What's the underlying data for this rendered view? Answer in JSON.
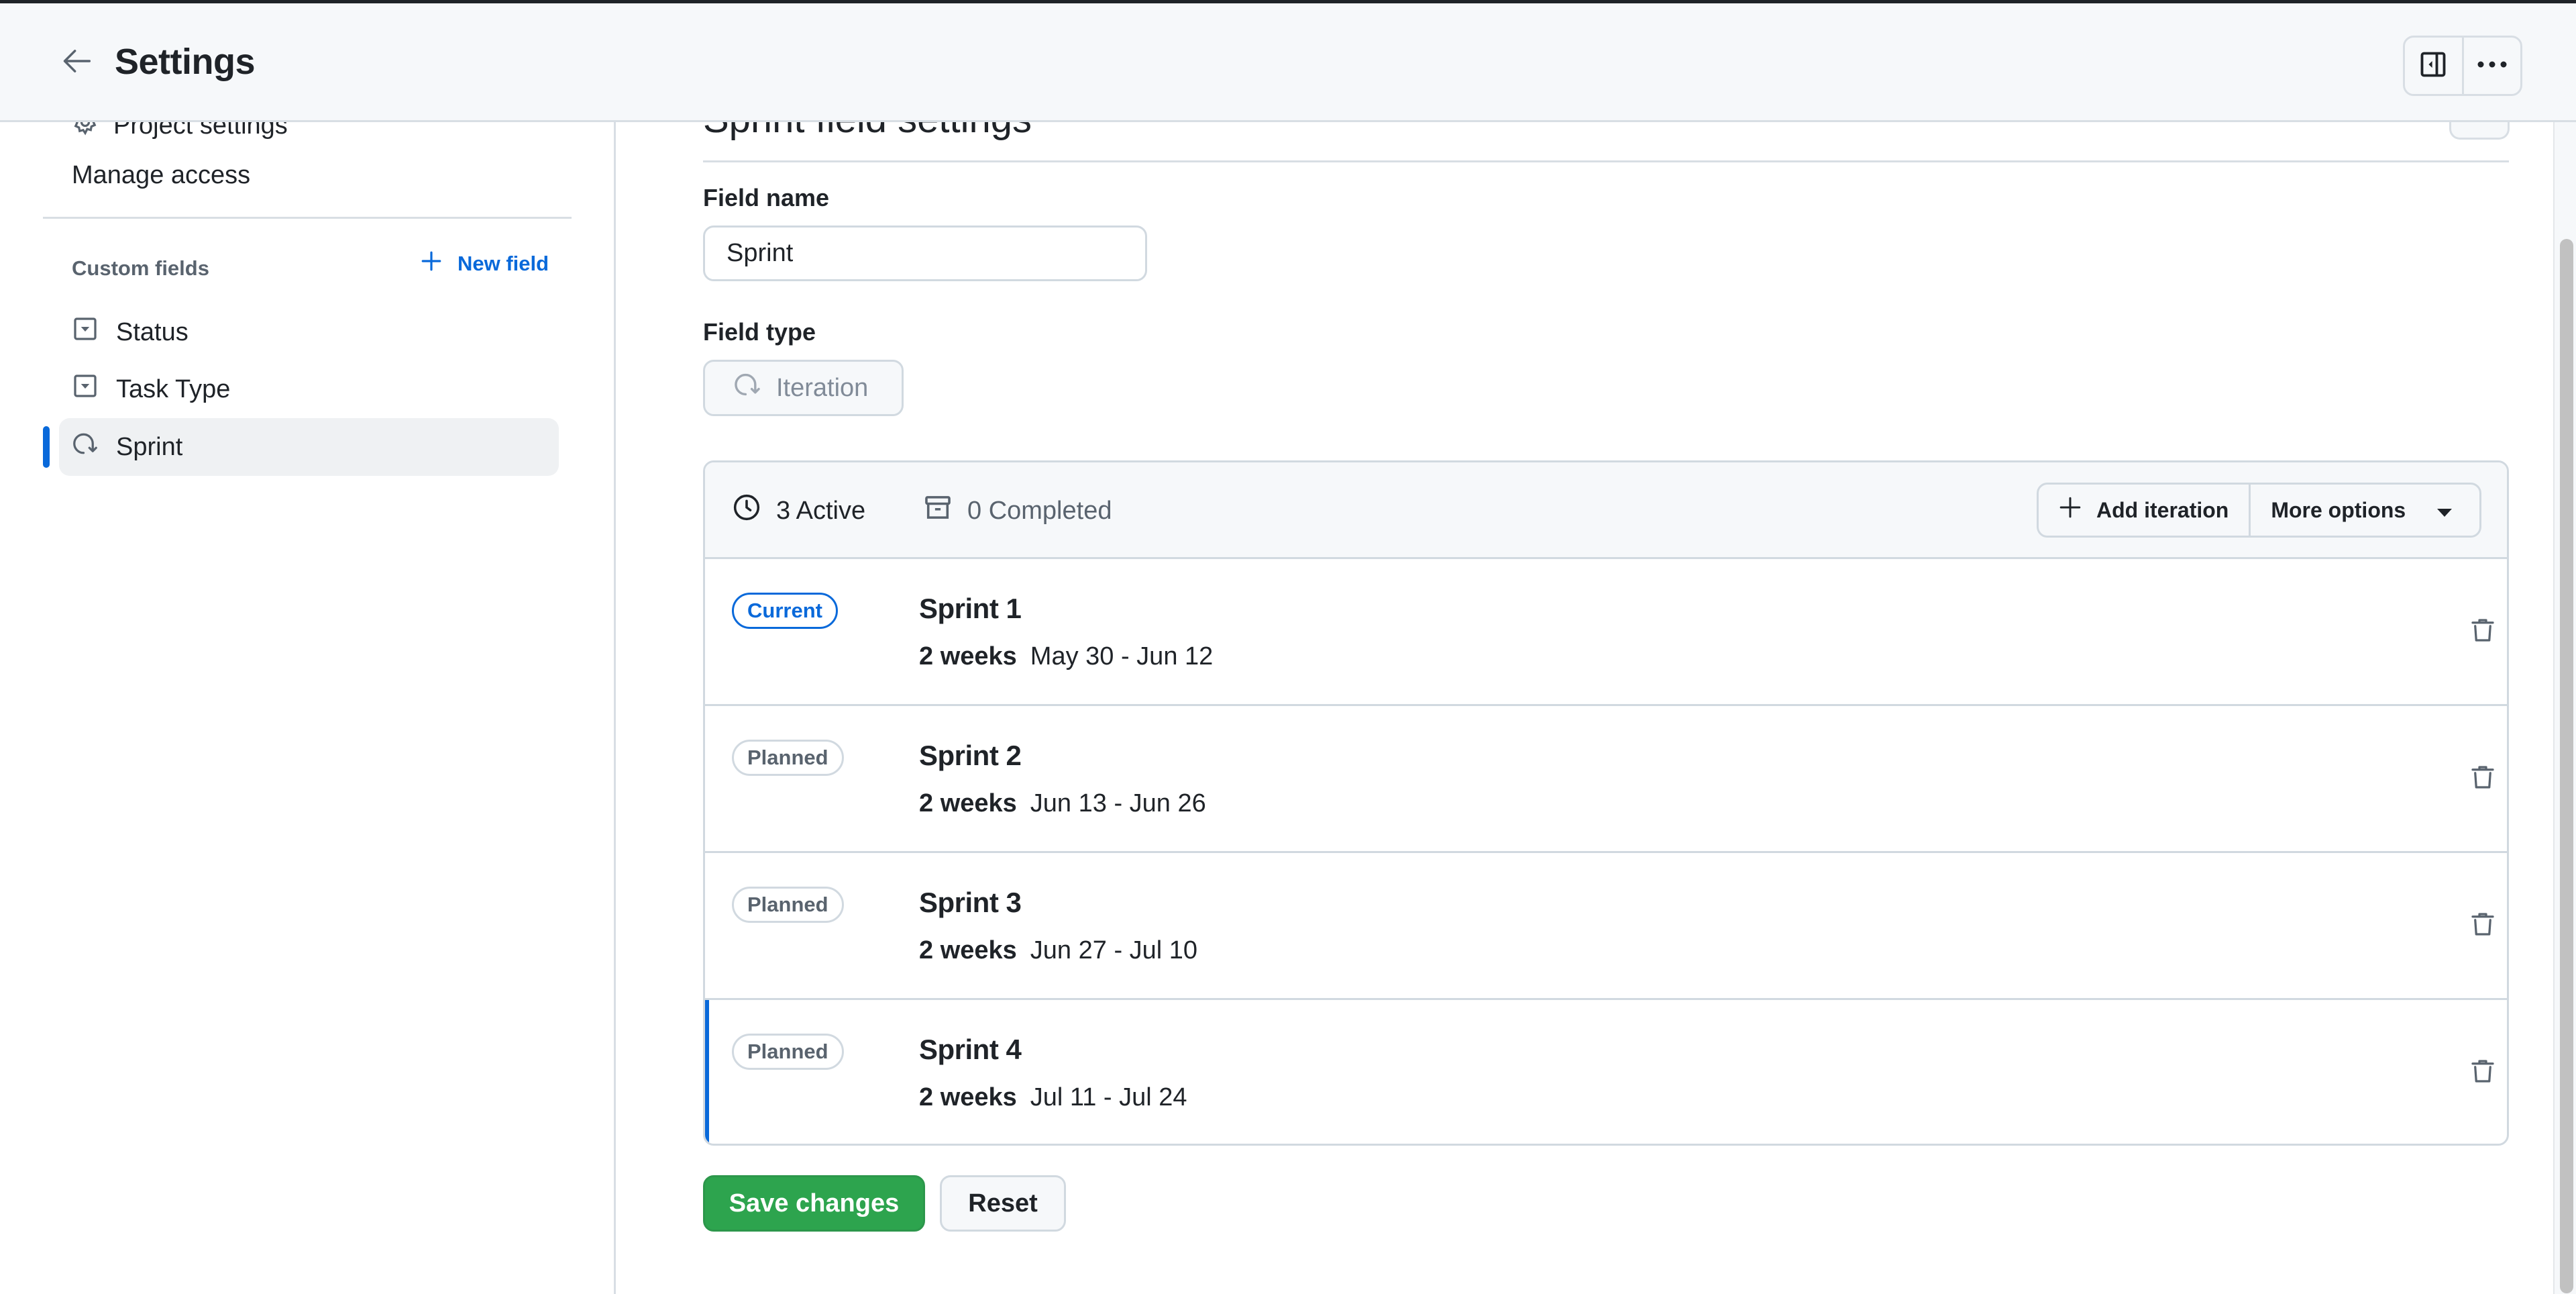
{
  "header": {
    "title": "Settings",
    "back_icon": "arrow-left-icon",
    "actions": [
      {
        "icon": "sidebar-collapse-icon",
        "label": "Toggle sidebar"
      },
      {
        "icon": "kebab-horizontal-icon",
        "label": "More"
      }
    ]
  },
  "sidebar": {
    "partial_item": {
      "label": "Project settings",
      "icon": "gear-icon"
    },
    "manage_access": "Manage access",
    "section_label": "Custom fields",
    "new_field_label": "New field",
    "items": [
      {
        "label": "Status",
        "icon": "single-select-icon",
        "active": false
      },
      {
        "label": "Task Type",
        "icon": "single-select-icon",
        "active": false
      },
      {
        "label": "Sprint",
        "icon": "iteration-icon",
        "active": true
      }
    ],
    "accent_color": "#0969da"
  },
  "main": {
    "section_title": "Sprint field settings",
    "field_name_label": "Field name",
    "field_name_value": "Sprint",
    "field_type_label": "Field type",
    "field_type_value": "Iteration",
    "tabs": {
      "active_label": "3 Active",
      "completed_label": "0 Completed"
    },
    "add_iteration_label": "Add iteration",
    "more_options_label": "More options",
    "iterations": [
      {
        "status": "Current",
        "name": "Sprint 1",
        "duration": "2 weeks",
        "dates": "May 30 - Jun 12"
      },
      {
        "status": "Planned",
        "name": "Sprint 2",
        "duration": "2 weeks",
        "dates": "Jun 13 - Jun 26"
      },
      {
        "status": "Planned",
        "name": "Sprint 3",
        "duration": "2 weeks",
        "dates": "Jun 27 - Jul 10"
      },
      {
        "status": "Planned",
        "name": "Sprint 4",
        "duration": "2 weeks",
        "dates": "Jul 11 - Jul 24"
      }
    ],
    "save_label": "Save changes",
    "reset_label": "Reset",
    "colors": {
      "primary_green": "#2da44e",
      "current_badge": "#0969da"
    }
  },
  "scrollbar": {
    "position_fraction": 0.0995,
    "visible_fraction": 0.9
  }
}
